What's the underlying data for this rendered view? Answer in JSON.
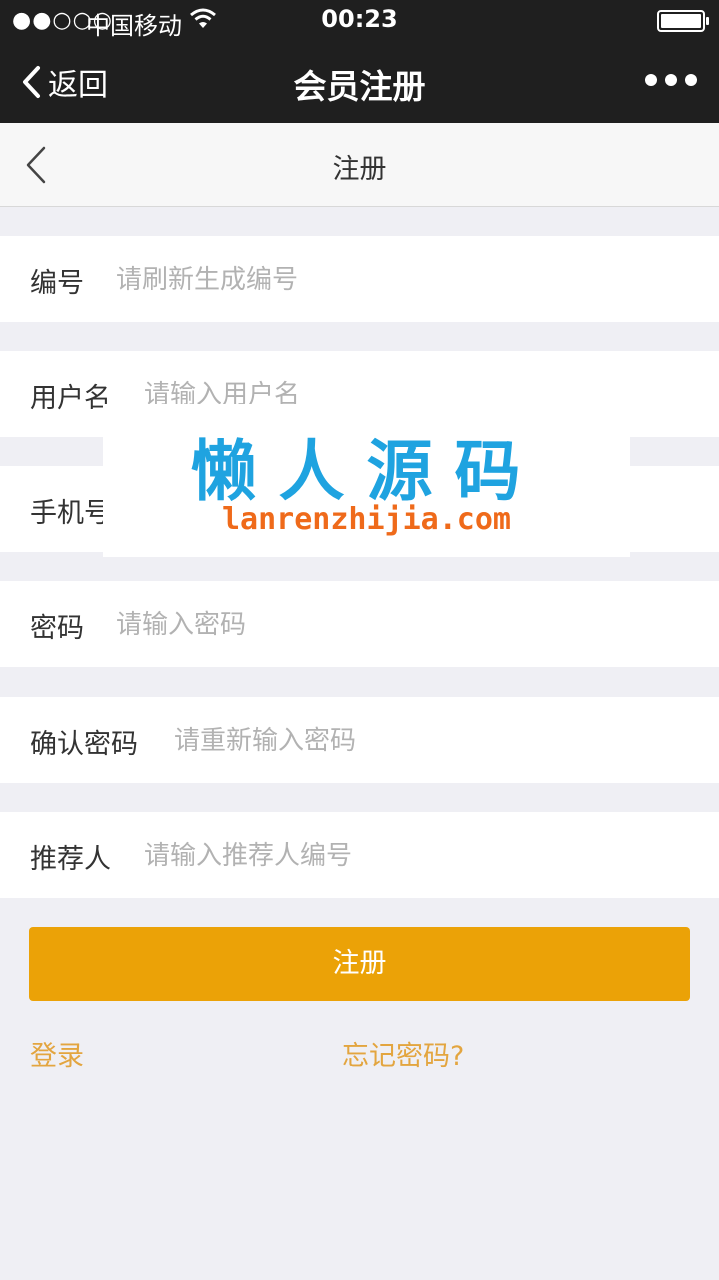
{
  "status_bar": {
    "signal": "●●○○○",
    "carrier": "中国移动",
    "time": "00:23"
  },
  "wechat_nav": {
    "back_label": "返回",
    "title": "会员注册"
  },
  "page_header": {
    "title": "注册"
  },
  "form": {
    "fields": [
      {
        "label": "编号",
        "placeholder": "请刷新生成编号"
      },
      {
        "label": "用户名",
        "placeholder": "请输入用户名"
      },
      {
        "label": "手机号",
        "placeholder": ""
      },
      {
        "label": "密码",
        "placeholder": "请输入密码"
      },
      {
        "label": "确认密码",
        "placeholder": "请重新输入密码"
      },
      {
        "label": "推荐人",
        "placeholder": "请输入推荐人编号"
      }
    ],
    "submit_label": "注册"
  },
  "links": {
    "login": "登录",
    "forgot": "忘记密码?"
  },
  "watermark": {
    "title": "懒人源码",
    "url": "lanrenzhijia.com"
  },
  "colors": {
    "accent": "#eba207",
    "link": "#e3a53f",
    "topbar": "#1f1f1f",
    "background": "#efeff4"
  }
}
